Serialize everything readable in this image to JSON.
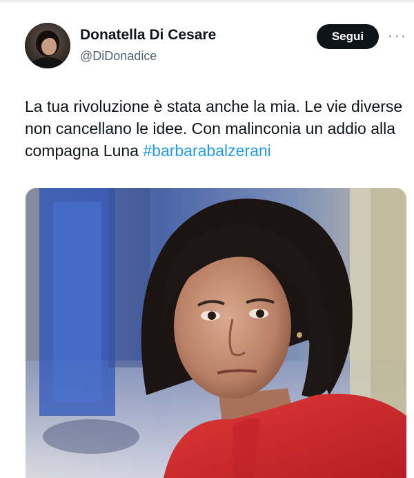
{
  "author": {
    "display_name": "Donatella Di Cesare",
    "handle": "@DiDonadice"
  },
  "actions": {
    "follow_label": "Segui",
    "more_icon": "more-horizontal-icon"
  },
  "tweet": {
    "text": "La tua rivoluzione è stata anche la mia. Le vie diverse non cancellano le idee. Con malinconia un addio alla compagna Luna ",
    "hashtag": "#barbarabalzerani"
  },
  "colors": {
    "hashtag": "#1d9bf0",
    "follow_button_bg": "#0f1419",
    "handle": "#536471",
    "photo_red_jacket": "#d42a2a"
  }
}
